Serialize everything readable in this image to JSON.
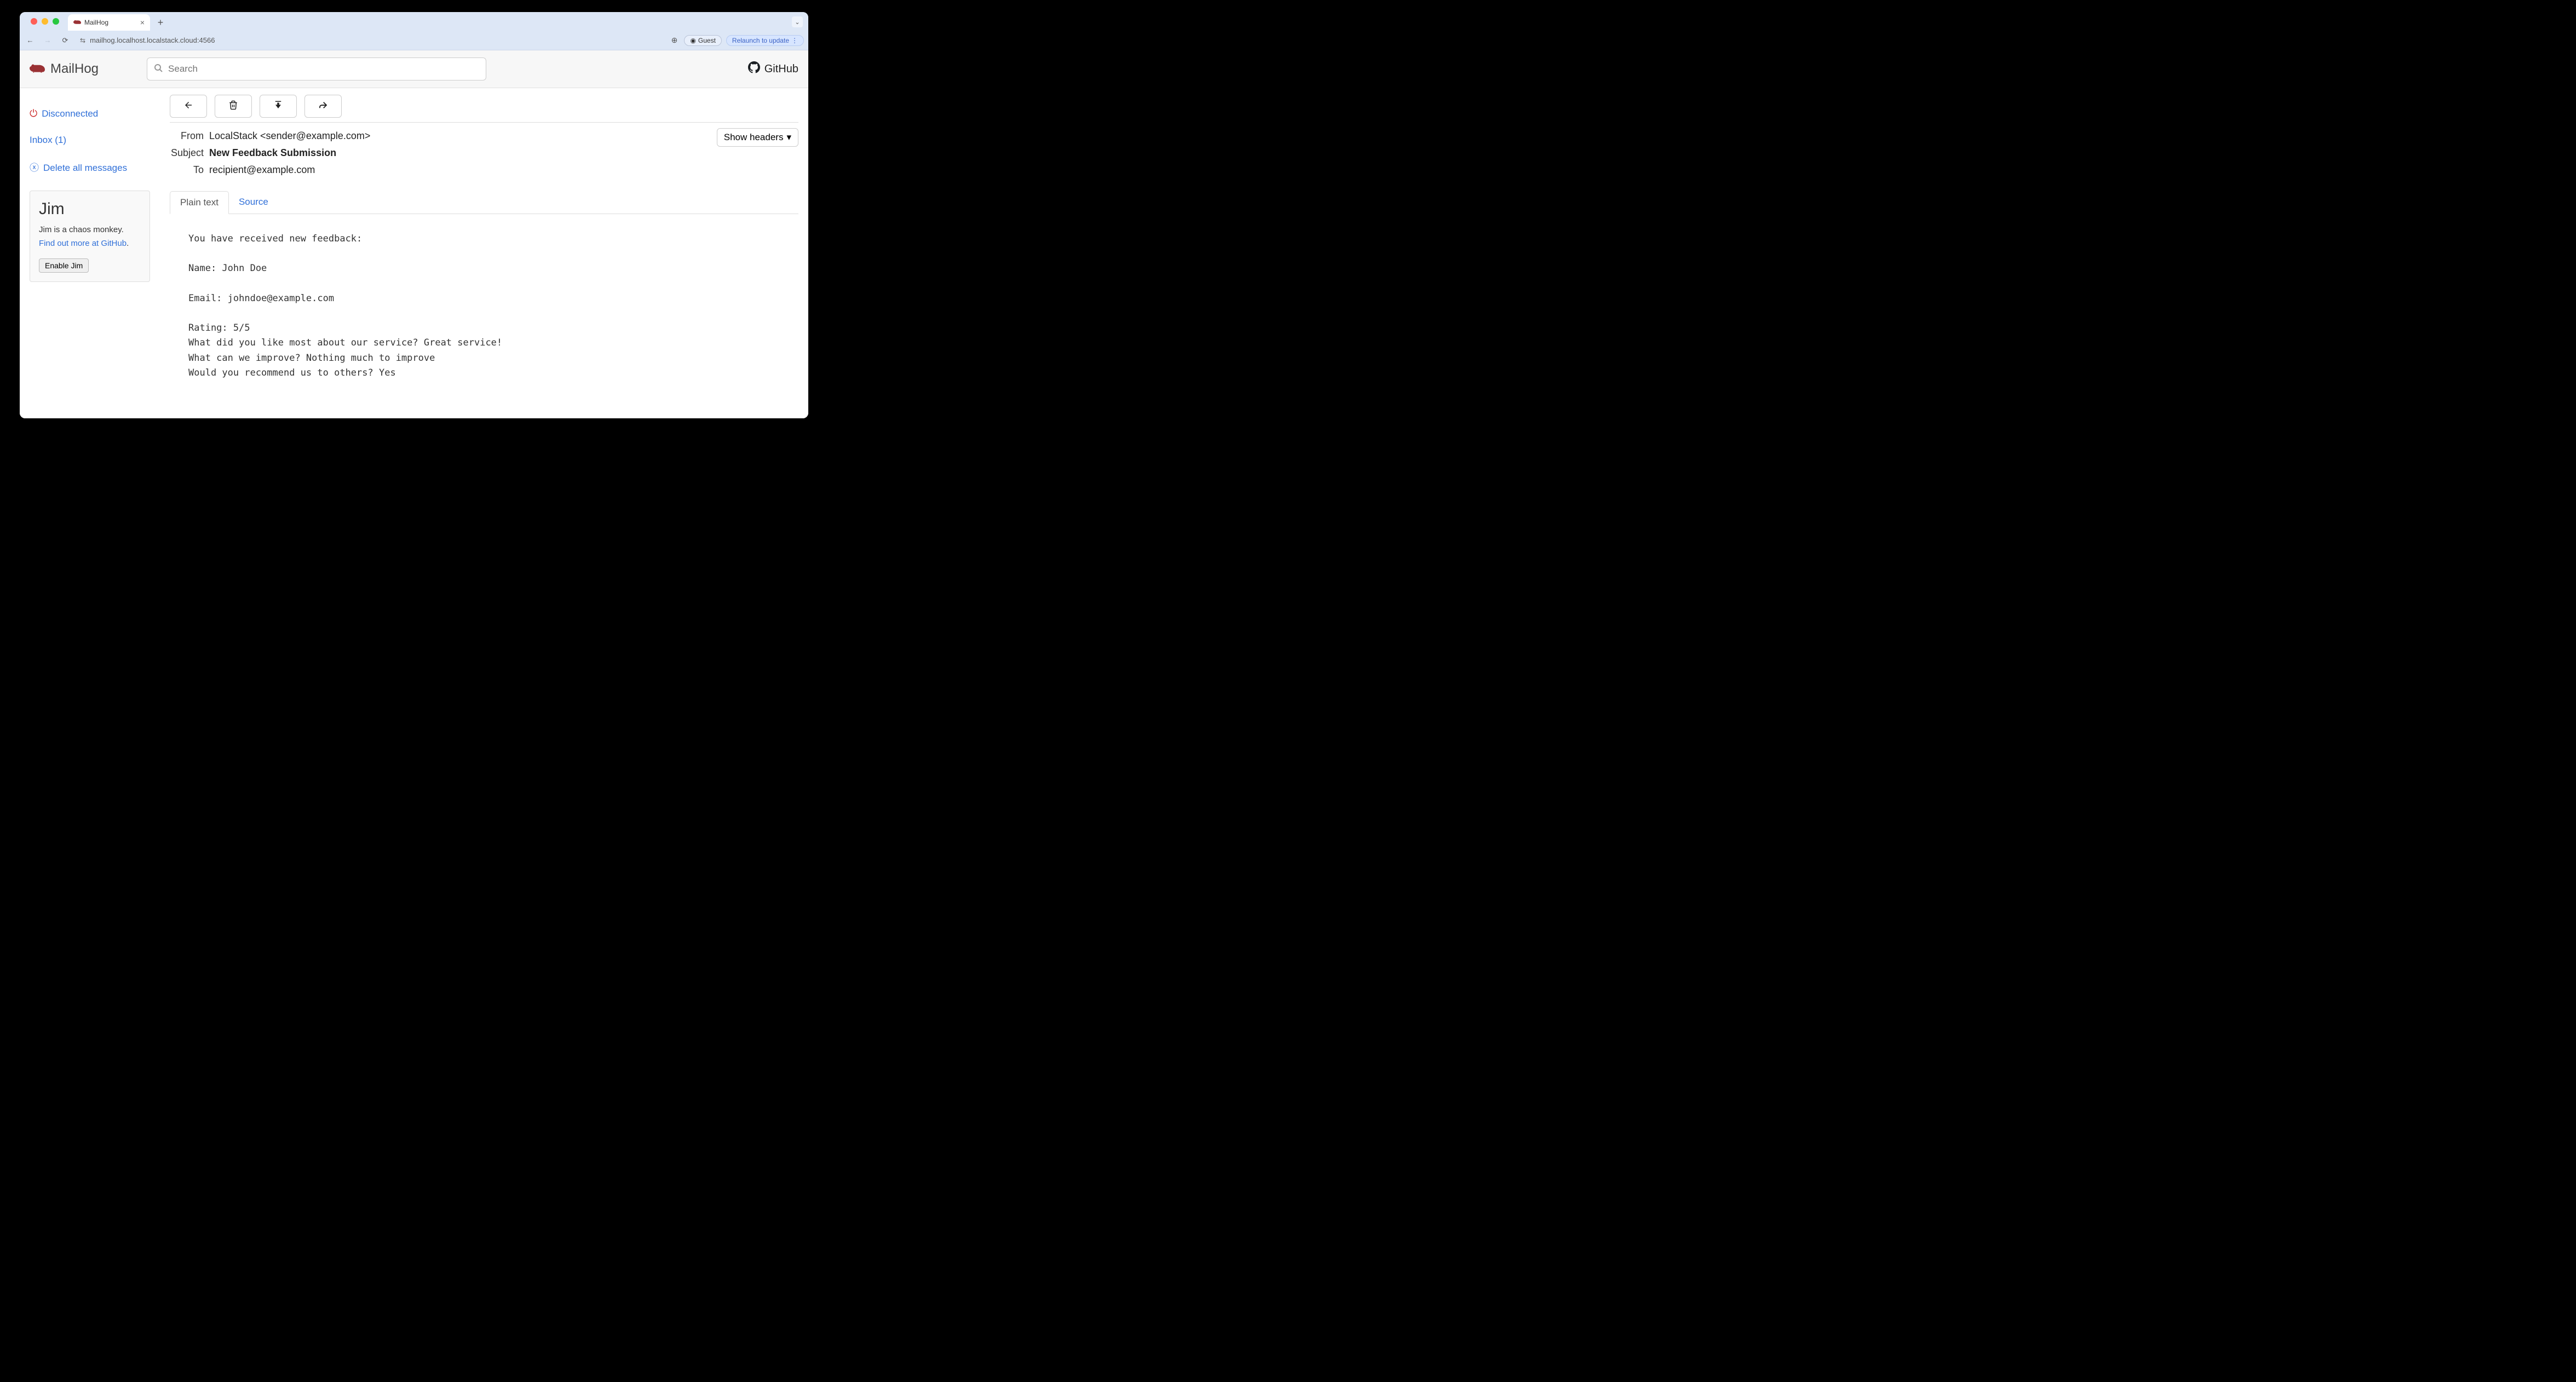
{
  "browser": {
    "tab_title": "MailHog",
    "url": "mailhog.localhost.localstack.cloud:4566",
    "guest_label": "Guest",
    "relaunch_label": "Relaunch to update"
  },
  "header": {
    "brand": "MailHog",
    "search_placeholder": "Search",
    "github_label": "GitHub"
  },
  "sidebar": {
    "status_label": "Disconnected",
    "inbox_label": "Inbox (1)",
    "delete_all_label": "Delete all messages",
    "jim": {
      "title": "Jim",
      "desc": "Jim is a chaos monkey.",
      "link_text": "Find out more at GitHub",
      "link_suffix": ".",
      "enable_label": "Enable Jim"
    }
  },
  "message": {
    "from_label": "From",
    "from_value": "LocalStack <sender@example.com>",
    "subject_label": "Subject",
    "subject_value": "New Feedback Submission",
    "to_label": "To",
    "to_value": "recipient@example.com",
    "show_headers_label": "Show headers",
    "tabs": {
      "plain": "Plain text",
      "source": "Source"
    },
    "body": "You have received new feedback:\n\nName: John Doe\n\nEmail: johndoe@example.com\n\nRating: 5/5\nWhat did you like most about our service? Great service!\nWhat can we improve? Nothing much to improve\nWould you recommend us to others? Yes"
  }
}
